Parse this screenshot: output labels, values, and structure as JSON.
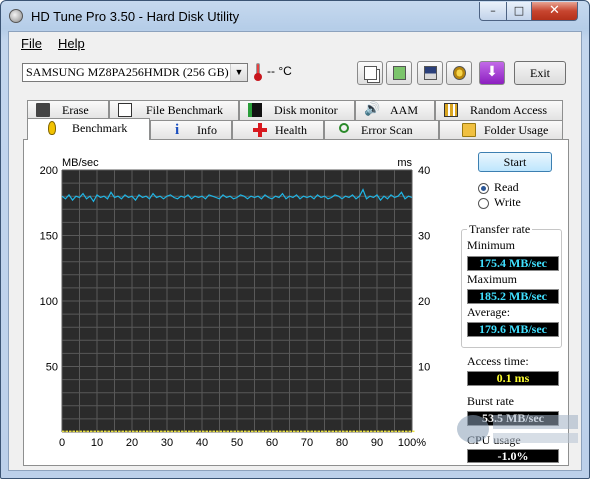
{
  "window": {
    "title": "HD Tune Pro 3.50 - Hard Disk Utility"
  },
  "menu": {
    "file": "File",
    "help": "Help"
  },
  "toolbar": {
    "drive": "SAMSUNG MZ8PA256HMDR (256 GB)",
    "temperature": "-- °C",
    "exit_label": "Exit"
  },
  "tabs_top": [
    "Erase",
    "File Benchmark",
    "Disk monitor",
    "AAM",
    "Random Access"
  ],
  "tabs_bottom": [
    "Benchmark",
    "Info",
    "Health",
    "Error Scan",
    "Folder Usage"
  ],
  "controls": {
    "start_label": "Start",
    "read_label": "Read",
    "write_label": "Write",
    "mode_selected": "Read"
  },
  "results": {
    "transfer_rate_title": "Transfer rate",
    "minimum_label": "Minimum",
    "minimum_value": "175.4 MB/sec",
    "maximum_label": "Maximum",
    "maximum_value": "185.2 MB/sec",
    "average_label": "Average:",
    "average_value": "179.6 MB/sec",
    "access_time_label": "Access time:",
    "access_time_value": "0.1 ms",
    "burst_rate_label": "Burst rate",
    "burst_rate_value": "53.5 MB/sec",
    "cpu_usage_label": "CPU usage",
    "cpu_usage_value": "-1.0%"
  },
  "colors": {
    "read_line": "#1fb6e6",
    "access_marks": "#e8e040",
    "value_cyan": "#40e0ff",
    "value_yellow": "#ffff30"
  },
  "chart_data": {
    "type": "line",
    "ylabel_left": "MB/sec",
    "ylabel_right": "ms",
    "y_ticks_left": [
      200,
      150,
      100,
      50
    ],
    "y_ticks_right": [
      40,
      30,
      20,
      10
    ],
    "x_ticks": [
      "0",
      "10",
      "20",
      "30",
      "40",
      "50",
      "60",
      "70",
      "80",
      "90",
      "100%"
    ],
    "ylim_left": [
      0,
      200
    ],
    "ylim_right": [
      0,
      40
    ],
    "xlim": [
      0,
      100
    ],
    "grid": true,
    "series": [
      {
        "color": "#1fb6e6",
        "x": [
          0,
          1,
          2,
          3,
          4,
          5,
          6,
          7,
          8,
          9,
          10,
          11,
          12,
          13,
          14,
          15,
          16,
          17,
          18,
          19,
          20,
          21,
          22,
          23,
          24,
          25,
          26,
          27,
          28,
          29,
          30,
          31,
          32,
          33,
          34,
          35,
          36,
          37,
          38,
          39,
          40,
          41,
          42,
          43,
          44,
          45,
          46,
          47,
          48,
          49,
          50,
          51,
          52,
          53,
          54,
          55,
          56,
          57,
          58,
          59,
          60,
          61,
          62,
          63,
          64,
          65,
          66,
          67,
          68,
          69,
          70,
          71,
          72,
          73,
          74,
          75,
          76,
          77,
          78,
          79,
          80,
          81,
          82,
          83,
          84,
          85,
          86,
          87,
          88,
          89,
          90,
          91,
          92,
          93,
          94,
          95,
          96,
          97,
          98,
          99,
          100
        ],
        "values": [
          180,
          178,
          181,
          177,
          180,
          179,
          182,
          178,
          180,
          176,
          181,
          179,
          180,
          178,
          183,
          179,
          180,
          178,
          181,
          179,
          180,
          177,
          181,
          179,
          180,
          178,
          182,
          179,
          180,
          178,
          180,
          181,
          179,
          178,
          180,
          179,
          181,
          178,
          180,
          179,
          180,
          178,
          181,
          180,
          179,
          178,
          181,
          179,
          180,
          178,
          179,
          181,
          180,
          178,
          180,
          179,
          180,
          178,
          181,
          179,
          178,
          180,
          179,
          182,
          178,
          180,
          179,
          181,
          178,
          180,
          179,
          180,
          178,
          181,
          179,
          180,
          178,
          179,
          181,
          180,
          178,
          180,
          179,
          181,
          178,
          180,
          185,
          178,
          180,
          179,
          181,
          177,
          180,
          178,
          181,
          179,
          180,
          183,
          178,
          180,
          179
        ]
      }
    ],
    "access_marks": {
      "color": "#e8e040",
      "value_ms": 0.1
    }
  }
}
